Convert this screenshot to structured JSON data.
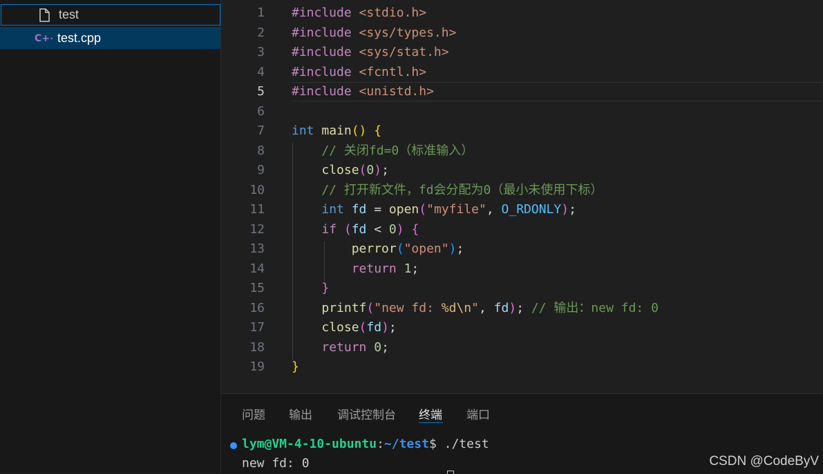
{
  "explorer": {
    "files": [
      {
        "name": "test",
        "icon": "file-icon"
      },
      {
        "name": "test.cpp",
        "icon": "cpp-file-icon",
        "icon_text": "C++",
        "selected": true
      }
    ]
  },
  "editor": {
    "active_line": 5,
    "line_numbers": [
      "1",
      "2",
      "3",
      "4",
      "5",
      "6",
      "7",
      "8",
      "9",
      "10",
      "11",
      "12",
      "13",
      "14",
      "15",
      "16",
      "17",
      "18",
      "19"
    ],
    "lines": [
      [
        {
          "t": "#include ",
          "c": "kw"
        },
        {
          "t": "<stdio.h>",
          "c": "st"
        }
      ],
      [
        {
          "t": "#include ",
          "c": "kw"
        },
        {
          "t": "<sys/types.h>",
          "c": "st"
        }
      ],
      [
        {
          "t": "#include ",
          "c": "kw"
        },
        {
          "t": "<sys/stat.h>",
          "c": "st"
        }
      ],
      [
        {
          "t": "#include ",
          "c": "kw"
        },
        {
          "t": "<fcntl.h>",
          "c": "st"
        }
      ],
      [
        {
          "t": "#include ",
          "c": "kw"
        },
        {
          "t": "<unistd.h>",
          "c": "st"
        }
      ],
      [],
      [
        {
          "t": "int ",
          "c": "ty"
        },
        {
          "t": "main",
          "c": "fn"
        },
        {
          "t": "() {",
          "c": "b1"
        }
      ],
      [
        {
          "t": "    // 关闭fd=0（标准输入）",
          "c": "cm"
        }
      ],
      [
        {
          "t": "    ",
          "c": "pl"
        },
        {
          "t": "close",
          "c": "fn"
        },
        {
          "t": "(",
          "c": "b2"
        },
        {
          "t": "0",
          "c": "nm"
        },
        {
          "t": ")",
          "c": "b2"
        },
        {
          "t": ";",
          "c": "pl"
        }
      ],
      [
        {
          "t": "    // 打开新文件，fd会分配为0（最小未使用下标）",
          "c": "cm"
        }
      ],
      [
        {
          "t": "    ",
          "c": "pl"
        },
        {
          "t": "int ",
          "c": "ty"
        },
        {
          "t": "fd",
          "c": "va"
        },
        {
          "t": " = ",
          "c": "pl"
        },
        {
          "t": "open",
          "c": "fn"
        },
        {
          "t": "(",
          "c": "b2"
        },
        {
          "t": "\"myfile\"",
          "c": "st"
        },
        {
          "t": ", ",
          "c": "pl"
        },
        {
          "t": "O_RDONLY",
          "c": "cn"
        },
        {
          "t": ")",
          "c": "b2"
        },
        {
          "t": ";",
          "c": "pl"
        }
      ],
      [
        {
          "t": "    ",
          "c": "pl"
        },
        {
          "t": "if ",
          "c": "kw"
        },
        {
          "t": "(",
          "c": "b2"
        },
        {
          "t": "fd",
          "c": "va"
        },
        {
          "t": " < ",
          "c": "pl"
        },
        {
          "t": "0",
          "c": "nm"
        },
        {
          "t": ")",
          "c": "b2"
        },
        {
          "t": " ",
          "c": "pl"
        },
        {
          "t": "{",
          "c": "b2"
        }
      ],
      [
        {
          "t": "        ",
          "c": "pl"
        },
        {
          "t": "perror",
          "c": "fn"
        },
        {
          "t": "(",
          "c": "b3"
        },
        {
          "t": "\"open\"",
          "c": "st"
        },
        {
          "t": ")",
          "c": "b3"
        },
        {
          "t": ";",
          "c": "pl"
        }
      ],
      [
        {
          "t": "        ",
          "c": "pl"
        },
        {
          "t": "return ",
          "c": "kw"
        },
        {
          "t": "1",
          "c": "nm"
        },
        {
          "t": ";",
          "c": "pl"
        }
      ],
      [
        {
          "t": "    ",
          "c": "pl"
        },
        {
          "t": "}",
          "c": "b2"
        }
      ],
      [
        {
          "t": "    ",
          "c": "pl"
        },
        {
          "t": "printf",
          "c": "fn"
        },
        {
          "t": "(",
          "c": "b2"
        },
        {
          "t": "\"new fd: ",
          "c": "st"
        },
        {
          "t": "%d\\n",
          "c": "es"
        },
        {
          "t": "\"",
          "c": "st"
        },
        {
          "t": ", ",
          "c": "pl"
        },
        {
          "t": "fd",
          "c": "va"
        },
        {
          "t": ")",
          "c": "b2"
        },
        {
          "t": "; ",
          "c": "pl"
        },
        {
          "t": "// 输出：new fd: 0",
          "c": "cm"
        }
      ],
      [
        {
          "t": "    ",
          "c": "pl"
        },
        {
          "t": "close",
          "c": "fn"
        },
        {
          "t": "(",
          "c": "b2"
        },
        {
          "t": "fd",
          "c": "va"
        },
        {
          "t": ")",
          "c": "b2"
        },
        {
          "t": ";",
          "c": "pl"
        }
      ],
      [
        {
          "t": "    ",
          "c": "pl"
        },
        {
          "t": "return ",
          "c": "kw"
        },
        {
          "t": "0",
          "c": "nm"
        },
        {
          "t": ";",
          "c": "pl"
        }
      ],
      [
        {
          "t": "}",
          "c": "b1"
        }
      ]
    ]
  },
  "panel": {
    "tabs": [
      {
        "label": "问题"
      },
      {
        "label": "输出"
      },
      {
        "label": "调试控制台"
      },
      {
        "label": "终端",
        "active": true
      },
      {
        "label": "端口"
      }
    ],
    "terminal": {
      "prompt_user": "lym@VM-4-10-ubuntu",
      "prompt_sep": ":",
      "prompt_path": "~/test",
      "prompt_symbol": "$",
      "command": " ./test",
      "output": "new fd: 0"
    }
  },
  "watermark": "CSDN @CodeByV",
  "colors": {
    "accent": "#0078d4",
    "selection": "#04395e",
    "terminal_user": "#23d18b",
    "terminal_path": "#3b8eea"
  }
}
